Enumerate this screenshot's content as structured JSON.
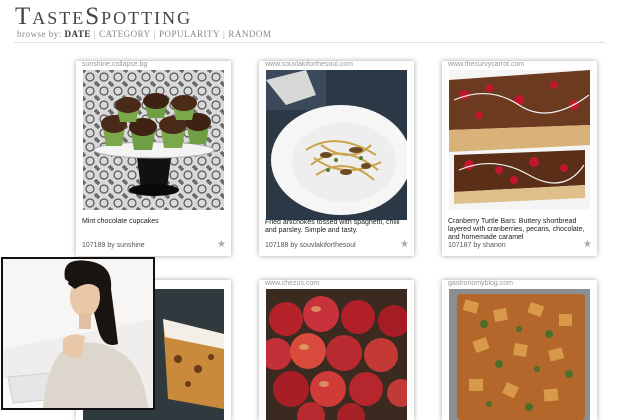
{
  "site": {
    "logo": "TasteSpotting"
  },
  "browse": {
    "label": "browse by:",
    "options": [
      "Date",
      "Category",
      "Popularity",
      "Random"
    ],
    "separator": "|"
  },
  "cards": [
    {
      "source": "sunshine.collapse.bg",
      "caption": "Mint chocolate cupcakes",
      "number": "107189",
      "by": "by",
      "user": "sunshine",
      "star": "★"
    },
    {
      "source": "www.souvlakiforthesoul.com",
      "caption": "Fried artichokes tossed with spaghetti, chilli and parsley. Simple and tasty.",
      "number": "107188",
      "by": "by",
      "user": "souvlakiforthesoul",
      "star": "★"
    },
    {
      "source": "www.thecurvycarrot.com",
      "caption": "Cranberry Turtle Bars: Buttery shortbread layered with cranberries, pecans, chocolate, and homemade caramel",
      "number": "107187",
      "by": "by",
      "user": "shanon",
      "star": "★"
    },
    {
      "source": "",
      "caption": "",
      "number": "",
      "by": "",
      "user": "",
      "star": ""
    },
    {
      "source": "www.chezus.com",
      "caption": "",
      "number": "",
      "by": "",
      "user": "",
      "star": ""
    },
    {
      "source": "gastronomyblog.com",
      "caption": "",
      "number": "",
      "by": "",
      "user": "",
      "star": ""
    }
  ],
  "colors": {
    "logo": "#444444",
    "selected": "#333333",
    "option": "#888888"
  }
}
